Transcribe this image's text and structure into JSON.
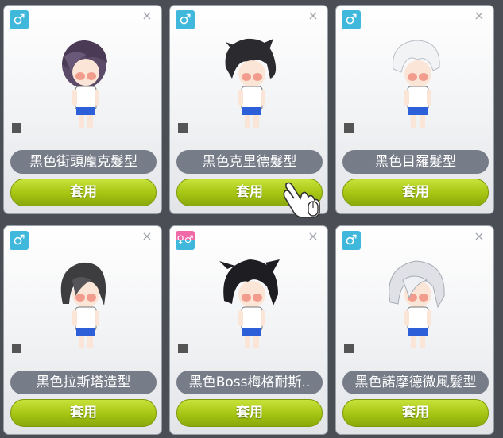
{
  "cards": [
    {
      "gender_icon": "♂",
      "name": "黑色街頭龐克髮型",
      "apply_label": "套用",
      "hair_color": "#5b4a68",
      "gender": "male"
    },
    {
      "gender_icon": "♂",
      "name": "黑色克里德髮型",
      "apply_label": "套用",
      "hair_color": "#2b2b2f",
      "gender": "male"
    },
    {
      "gender_icon": "♂",
      "name": "黑色目羅髮型",
      "apply_label": "套用",
      "hair_color": "#f1f3f5",
      "gender": "male"
    },
    {
      "gender_icon": "♂",
      "name": "黑色拉斯塔造型",
      "apply_label": "套用",
      "hair_color": "#3d3d3f",
      "gender": "male"
    },
    {
      "gender_icon": "♀♂",
      "name": "黑色Boss梅格耐斯..",
      "apply_label": "套用",
      "hair_color": "#1e1e22",
      "gender": "unisex"
    },
    {
      "gender_icon": "♂",
      "name": "黑色諾摩德微風髮型",
      "apply_label": "套用",
      "hair_color": "#dfe1e6",
      "gender": "male"
    }
  ],
  "close_icon": "×",
  "colors": {
    "button": "#a5c412",
    "name_pill": "#767c88",
    "male_badge": "#40b8dc",
    "female_badge": "#f06aa8"
  }
}
